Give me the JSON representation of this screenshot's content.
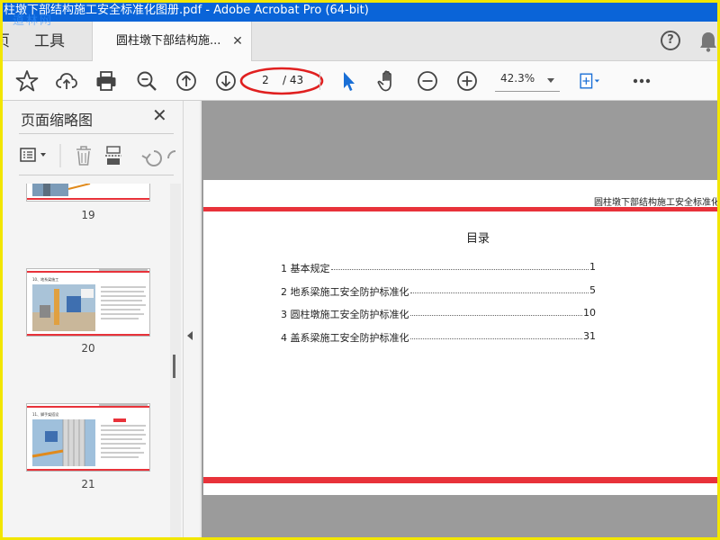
{
  "window": {
    "title": "柱墩下部结构施工安全标准化图册.pdf - Adobe Acrobat Pro (64-bit)"
  },
  "watermark": "道林网",
  "tabs": {
    "home": "页",
    "tools": "工具",
    "document": "圆柱墩下部结构施..."
  },
  "toolbar": {
    "current_page": "2",
    "total_pages": "/ 43",
    "zoom": "42.3%"
  },
  "thumbnails_pane": {
    "title": "页面缩略图",
    "pages": [
      "19",
      "20",
      "21"
    ],
    "thumb_texts": [
      "10、地系梁施工",
      "11、脚手架搭设"
    ]
  },
  "document": {
    "header": "圆柱墩下部结构施工安全标准化",
    "toc_title": "目录",
    "toc": [
      {
        "label": "1 基本规定",
        "page": "1"
      },
      {
        "label": "2 地系梁施工安全防护标准化",
        "page": "5"
      },
      {
        "label": "3 圆柱墩施工安全防护标准化",
        "page": "10"
      },
      {
        "label": "4 盖系梁施工安全防护标准化",
        "page": "31"
      }
    ]
  },
  "colors": {
    "titlebar": "#0a64d8",
    "accent_red": "#e8323a",
    "cursor_blue": "#1a6fd6",
    "annotation_red": "#e02020"
  }
}
